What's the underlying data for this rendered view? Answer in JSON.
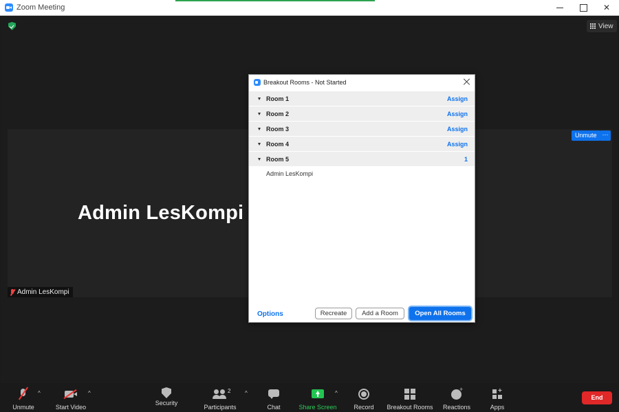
{
  "window": {
    "title": "Zoom Meeting"
  },
  "meeting": {
    "view_label": "View",
    "participant_display_name": "Admin LesKompi",
    "name_tag": "Admin LesKompi",
    "tile_unmute_label": "Unmute",
    "tile_more_label": "···"
  },
  "dialog": {
    "title": "Breakout Rooms - Not Started",
    "rooms": [
      {
        "name": "Room 1",
        "action": "Assign"
      },
      {
        "name": "Room 2",
        "action": "Assign"
      },
      {
        "name": "Room 3",
        "action": "Assign"
      },
      {
        "name": "Room 4",
        "action": "Assign"
      },
      {
        "name": "Room 5",
        "action": "1",
        "members": [
          "Admin LesKompi"
        ]
      }
    ],
    "options_label": "Options",
    "recreate_label": "Recreate",
    "add_room_label": "Add a Room",
    "open_all_label": "Open All Rooms"
  },
  "toolbar": {
    "unmute": "Unmute",
    "start_video": "Start Video",
    "security": "Security",
    "participants": "Participants",
    "participants_count": "2",
    "chat": "Chat",
    "share_screen": "Share Screen",
    "record": "Record",
    "breakout_rooms": "Breakout Rooms",
    "reactions": "Reactions",
    "apps": "Apps",
    "end": "End",
    "caret": "^"
  },
  "colors": {
    "accent": "#0e72ed",
    "share_green": "#23c552",
    "end_red": "#e02828",
    "security_green": "#23a559"
  },
  "icons": {
    "app": "zoom-icon",
    "shield": "encryption-shield-icon",
    "view": "grid-view-icon",
    "mic": "mic-muted-icon",
    "video": "video-off-icon"
  }
}
